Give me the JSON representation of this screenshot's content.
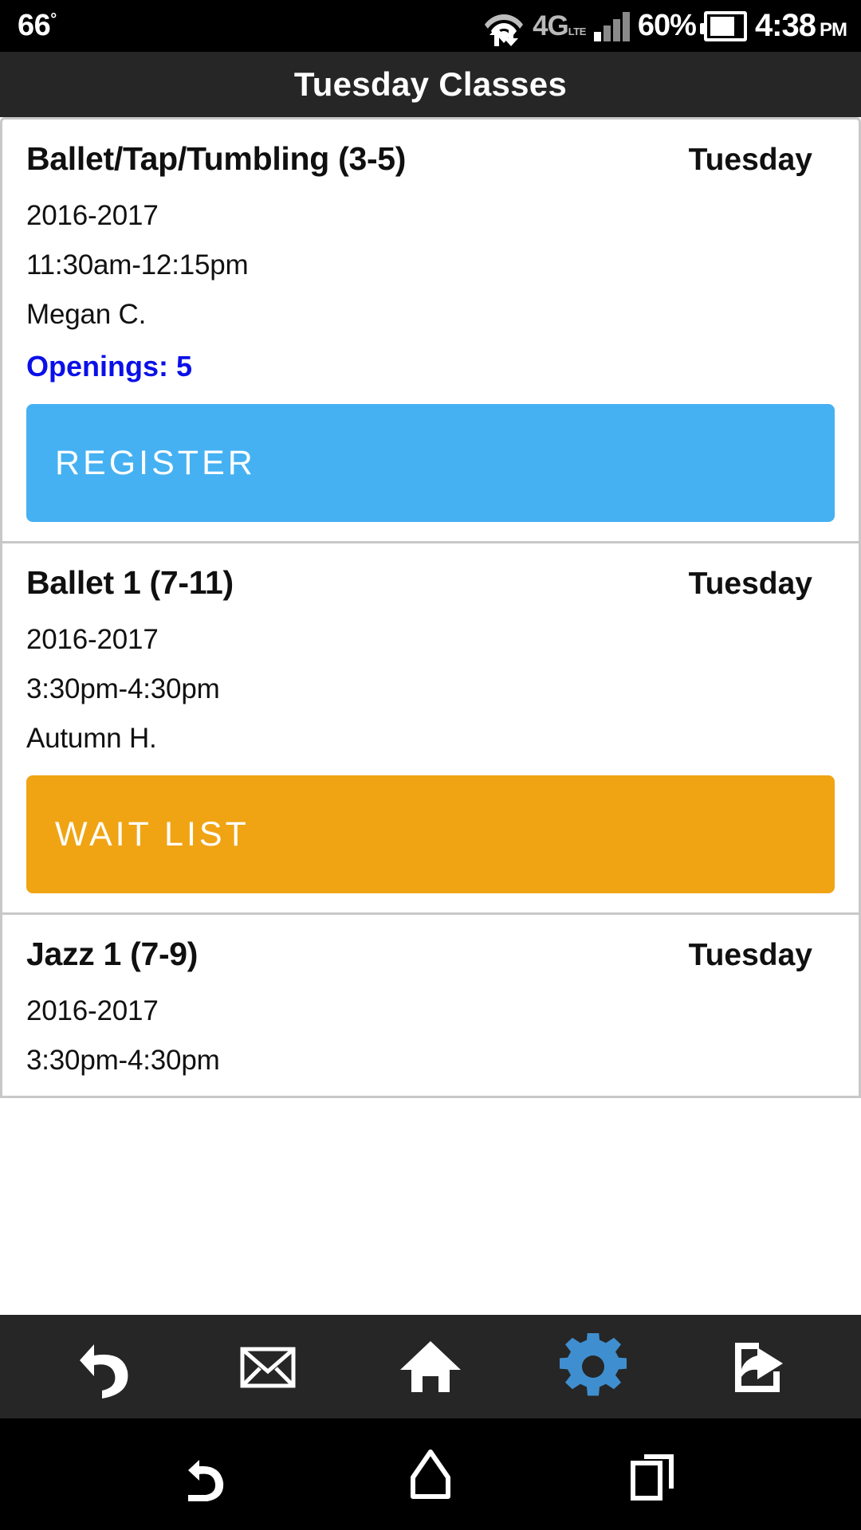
{
  "status_bar": {
    "temperature": "66",
    "degree_symbol": "°",
    "wifi_icon": "wifi-with-transfer-arrows-icon",
    "network_label": "4G",
    "network_sub": "LTE",
    "signal_icon": "signal-bars-icon",
    "battery_percent": "60%",
    "battery_icon": "battery-icon",
    "time": "4:38",
    "time_period": "PM"
  },
  "app_bar": {
    "title": "Tuesday Classes"
  },
  "classes": [
    {
      "name": "Ballet/Tap/Tumbling (3-5)",
      "day": "Tuesday",
      "season": "2016-2017",
      "time": "11:30am-12:15pm",
      "instructor": "Megan C.",
      "openings": "Openings: 5",
      "action_label": "REGISTER",
      "action_type": "register",
      "action_color": "#45b1f2"
    },
    {
      "name": "Ballet 1 (7-11)",
      "day": "Tuesday",
      "season": "2016-2017",
      "time": "3:30pm-4:30pm",
      "instructor": "Autumn H.",
      "openings": "",
      "action_label": "WAIT LIST",
      "action_type": "waitlist",
      "action_color": "#f0a413"
    },
    {
      "name": "Jazz 1 (7-9)",
      "day": "Tuesday",
      "season": "2016-2017",
      "time": "3:30pm-4:30pm",
      "instructor": "",
      "openings": "",
      "action_label": "",
      "action_type": "none",
      "action_color": ""
    }
  ],
  "toolbar": {
    "items": [
      {
        "icon": "undo-back-arrow-icon",
        "color": "#ffffff",
        "active": false
      },
      {
        "icon": "envelope-mail-icon",
        "color": "#ffffff",
        "active": false
      },
      {
        "icon": "home-icon",
        "color": "#ffffff",
        "active": false
      },
      {
        "icon": "gear-settings-icon",
        "color": "#3f8fd0",
        "active": true
      },
      {
        "icon": "share-export-icon",
        "color": "#ffffff",
        "active": false
      }
    ],
    "active_color": "#3f8fd0"
  },
  "nav_bar": {
    "items": [
      {
        "icon": "android-back-icon"
      },
      {
        "icon": "android-home-icon"
      },
      {
        "icon": "android-recents-icon"
      }
    ]
  },
  "colors": {
    "accent_blue": "#45b1f2",
    "accent_orange": "#f0a413",
    "link_blue": "#0b10e8",
    "app_bar_bg": "#262626",
    "card_border": "#c8c8c8"
  }
}
